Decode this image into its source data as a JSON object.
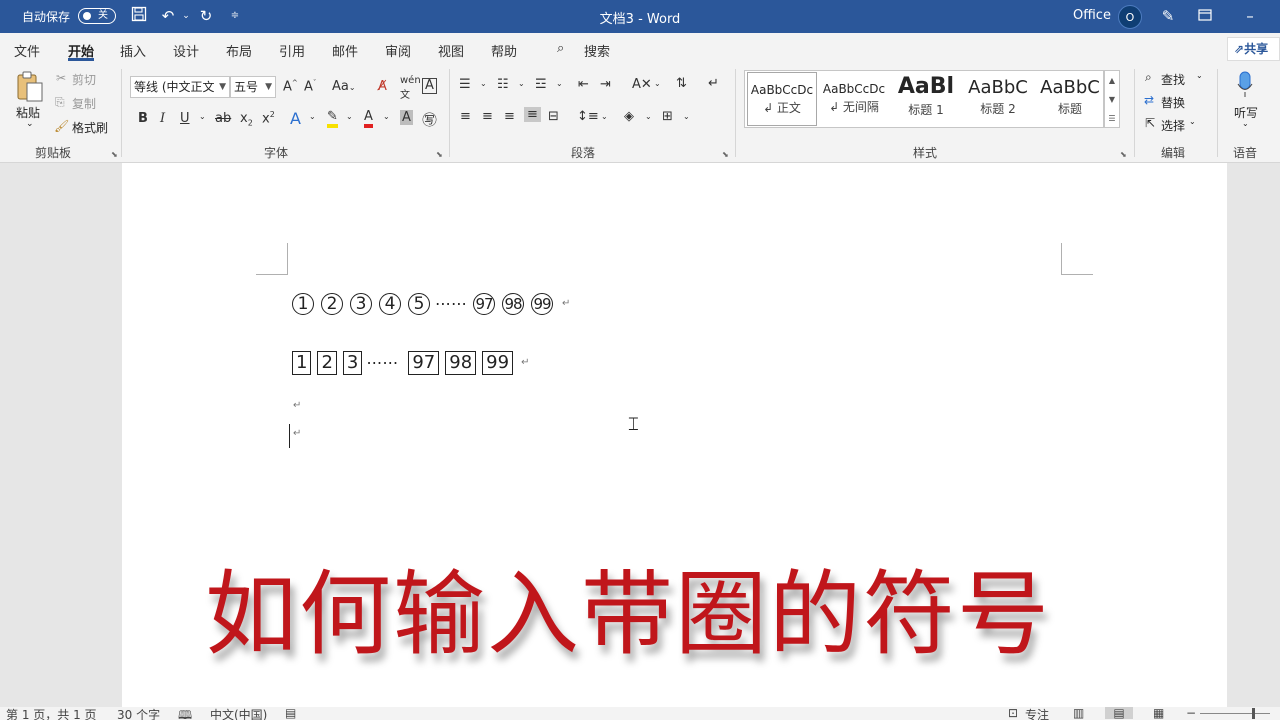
{
  "titlebar": {
    "autosave_label": "自动保存",
    "autosave_state": "关",
    "doc_title": "文档3  -  Word",
    "account_label": "Office",
    "avatar_initial": "O"
  },
  "menu": {
    "tabs": [
      "文件",
      "开始",
      "插入",
      "设计",
      "布局",
      "引用",
      "邮件",
      "审阅",
      "视图",
      "帮助"
    ],
    "active_tab": "开始",
    "search_label": "搜索",
    "share_label": "共享"
  },
  "ribbon": {
    "clipboard": {
      "paste": "粘贴",
      "cut": "剪切",
      "copy": "复制",
      "format_painter": "格式刷",
      "group": "剪贴板"
    },
    "font": {
      "font_name": "等线 (中文正文",
      "font_size": "五号",
      "group": "字体"
    },
    "paragraph": {
      "group": "段落"
    },
    "styles": {
      "items": [
        {
          "sample": "AaBbCcDc",
          "name": "↲ 正文"
        },
        {
          "sample": "AaBbCcDc",
          "name": "↲ 无间隔"
        },
        {
          "sample": "AaBl",
          "name": "标题 1"
        },
        {
          "sample": "AaBbC",
          "name": "标题 2"
        },
        {
          "sample": "AaBbC",
          "name": "标题"
        }
      ],
      "group": "样式"
    },
    "editing": {
      "find": "查找",
      "replace": "替换",
      "select": "选择",
      "group": "编辑"
    },
    "voice": {
      "dictate": "听写",
      "group": "语音"
    }
  },
  "document": {
    "circled_row": [
      "1",
      "2",
      "3",
      "4",
      "5",
      "97",
      "98",
      "99"
    ],
    "ellipsis": "⋯⋯",
    "boxed_row": [
      "1",
      "2",
      "3",
      "97",
      "98",
      "99"
    ],
    "boxed_ellipsis": "⋯⋯",
    "para_mark": "↵",
    "overlay_title": "如何输入带圈的符号"
  },
  "statusbar": {
    "page": "第 1 页，共 1 页",
    "words": "30 个字",
    "language": "中文(中国)",
    "focus": "专注"
  },
  "colors": {
    "titlebar": "#2b579a",
    "overlay_title": "#c0161b"
  }
}
